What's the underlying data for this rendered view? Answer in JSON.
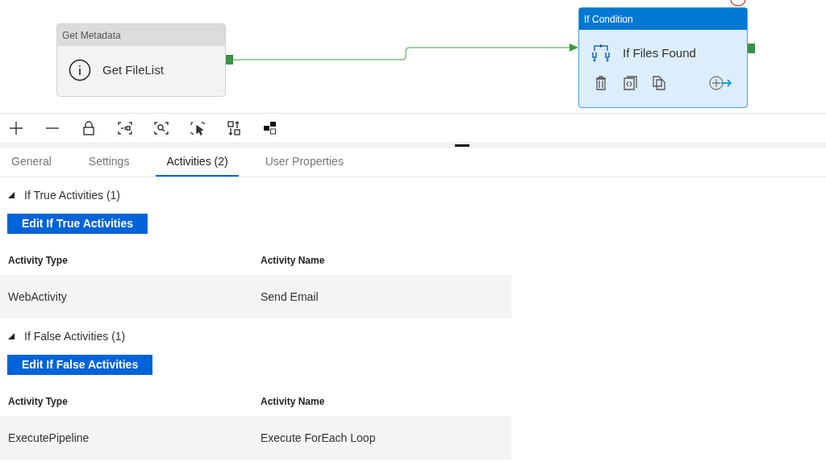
{
  "canvas": {
    "nodes": [
      {
        "kind": "metadata",
        "category": "Get Metadata",
        "name": "Get FileList",
        "selected": false
      },
      {
        "kind": "condition",
        "category": "If Condition",
        "name": "If Files Found",
        "selected": true
      }
    ]
  },
  "tabs": [
    {
      "label": "General",
      "selected": false
    },
    {
      "label": "Settings",
      "selected": false
    },
    {
      "label": "Activities (2)",
      "selected": true
    },
    {
      "label": "User Properties",
      "selected": false
    }
  ],
  "sections": [
    {
      "title": "If True Activities (1)",
      "expanded": true,
      "button": "Edit If True Activities",
      "columns": [
        "Activity Type",
        "Activity Name"
      ],
      "rows": [
        [
          "WebActivity",
          "Send Email"
        ]
      ]
    },
    {
      "title": "If False Activities (1)",
      "expanded": true,
      "button": "Edit If False Activities",
      "columns": [
        "Activity Type",
        "Activity Name"
      ],
      "rows": [
        [
          "ExecutePipeline",
          "Execute ForEach Loop"
        ]
      ]
    }
  ]
}
